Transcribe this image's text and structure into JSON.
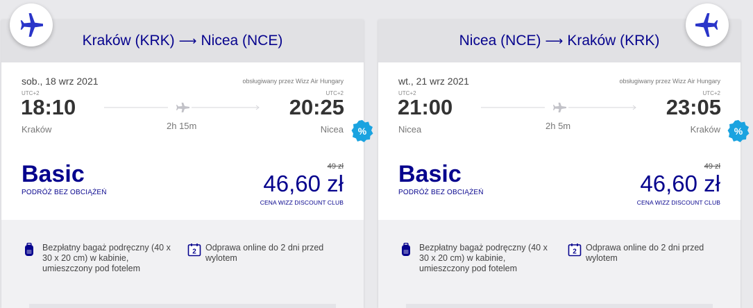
{
  "cards": [
    {
      "route": {
        "from": "Kraków (KRK)",
        "to": "Nicea (NCE)"
      },
      "date": "sob., 18 wrz 2021",
      "operated_by": "obsługiwany przez Wizz Air Hungary",
      "departure": {
        "tz": "UTC+2",
        "time": "18:10",
        "city": "Kraków"
      },
      "arrival": {
        "tz": "UTC+2",
        "time": "20:25",
        "city": "Nicea"
      },
      "duration": "2h 15m",
      "fare": {
        "name": "Basic",
        "subtitle": "PODRÓŻ BEZ OBCIĄŻEŃ",
        "old_price": "49 zł",
        "price": "46,60 zł",
        "price_note": "CENA WIZZ DISCOUNT CLUB",
        "discount_symbol": "%"
      },
      "features": [
        {
          "icon": "backpack-icon",
          "text": "Bezpłatny bagaż podręczny (40 x 30 x 20 cm) w kabinie, umieszczony pod fotelem"
        },
        {
          "icon": "calendar-2-icon",
          "badge": "2",
          "text": "Odprawa online do 2 dni przed wylotem"
        }
      ]
    },
    {
      "route": {
        "from": "Nicea (NCE)",
        "to": "Kraków (KRK)"
      },
      "date": "wt., 21 wrz 2021",
      "operated_by": "obsługiwany przez Wizz Air Hungary",
      "departure": {
        "tz": "UTC+2",
        "time": "21:00",
        "city": "Nicea"
      },
      "arrival": {
        "tz": "UTC+2",
        "time": "23:05",
        "city": "Kraków"
      },
      "duration": "2h 5m",
      "fare": {
        "name": "Basic",
        "subtitle": "PODRÓŻ BEZ OBCIĄŻEŃ",
        "old_price": "49 zł",
        "price": "46,60 zł",
        "price_note": "CENA WIZZ DISCOUNT CLUB",
        "discount_symbol": "%"
      },
      "features": [
        {
          "icon": "backpack-icon",
          "text": "Bezpłatny bagaż podręczny (40 x 30 x 20 cm) w kabinie, umieszczony pod fotelem"
        },
        {
          "icon": "calendar-2-icon",
          "badge": "2",
          "text": "Odprawa online do 2 dni przed wylotem"
        }
      ]
    }
  ],
  "colors": {
    "brand": "#06038d",
    "discount": "#1aa3e0",
    "text": "#444444"
  },
  "route_arrow": "⟶"
}
